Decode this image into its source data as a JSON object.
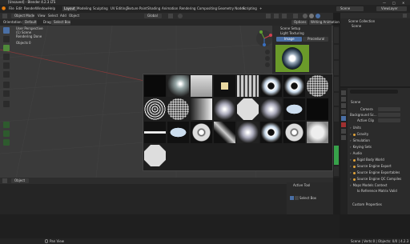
{
  "window": {
    "title": "[Unsaved] - Blender 4.2.3 LTS"
  },
  "menu": [
    "File",
    "Edit",
    "Render",
    "Window",
    "Help"
  ],
  "workspaces": [
    "Layout",
    "Modeling",
    "Sculpting",
    "UV Editing",
    "Texture Paint",
    "Shading",
    "Animation",
    "Rendering",
    "Compositing",
    "Geometry Nodes",
    "Scripting"
  ],
  "header": {
    "scene_label": "Scene",
    "view_layer_label": "ViewLayer"
  },
  "viewport_header": {
    "mode": "Object Mode",
    "view": "View",
    "select": "Select",
    "add": "Add",
    "object": "Object",
    "shading": "Global"
  },
  "viewport_subheader": {
    "orientation": "Orientation:",
    "orientation_value": "Default",
    "drag": "Drag:",
    "drag_value": "Select Box"
  },
  "overlay": {
    "line1": "User Perspective",
    "line2": "(1) Scene",
    "line3": "Rendering Done",
    "objects_label": "Objects",
    "objects_value": "0"
  },
  "options_buttons": {
    "options": "Options",
    "writing": "Writing Animation"
  },
  "light_panel": {
    "scene_setup": "Scene Setup",
    "light_texturing": "Light Texturing",
    "tab_image": "Image",
    "tab_procedural": "Procedural"
  },
  "outliner": {
    "collection": "Scene Collection",
    "scene": "Scene"
  },
  "properties": {
    "section": "Scene",
    "camera_label": "Camera",
    "background_label": "Background Sc...",
    "active_clip_label": "Active Clip",
    "items": [
      "Units",
      "Gravity",
      "Simulation",
      "Keying Sets",
      "Audio",
      "Rigid Body World",
      "Source Engine Export",
      "Source Engine Exportables",
      "Source Engine QC Compiles",
      "Maps Models Context"
    ],
    "items_dot": [
      false,
      true,
      false,
      false,
      false,
      true,
      true,
      true,
      true,
      false
    ],
    "ref_label": "Io Reference Matrix Valid",
    "custom_props": "Custom Properties"
  },
  "side_tabs": [
    "Item",
    "Tool",
    "View",
    "Render",
    "Physics",
    "Edit",
    "Photographer",
    "Scene",
    "BlenderKit"
  ],
  "timeline": {
    "object": "Object",
    "view": "View"
  },
  "active_tool": {
    "title": "Active Tool",
    "select_box": "Select Box"
  },
  "status": {
    "left": "Pan View",
    "right": "Scene | Verts:0 | Objects: 0/0 | 4.2.3"
  },
  "thumbnails": [
    {
      "kind": "dark"
    },
    {
      "kind": "flare"
    },
    {
      "kind": "window"
    },
    {
      "kind": "softbox"
    },
    {
      "kind": "grid"
    },
    {
      "kind": "ring"
    },
    {
      "kind": "ring"
    },
    {
      "kind": "dots"
    },
    {
      "kind": "rings"
    },
    {
      "kind": "dots"
    },
    {
      "kind": "gradient"
    },
    {
      "kind": "glow"
    },
    {
      "kind": "octagon"
    },
    {
      "kind": "glow"
    },
    {
      "kind": "rect"
    },
    {
      "kind": "dark"
    },
    {
      "kind": "strip"
    },
    {
      "kind": "rect"
    },
    {
      "kind": "disc"
    },
    {
      "kind": "diamond"
    },
    {
      "kind": "glow"
    },
    {
      "kind": "ring"
    },
    {
      "kind": "disc"
    },
    {
      "kind": "soft"
    },
    {
      "kind": "octagon"
    }
  ]
}
